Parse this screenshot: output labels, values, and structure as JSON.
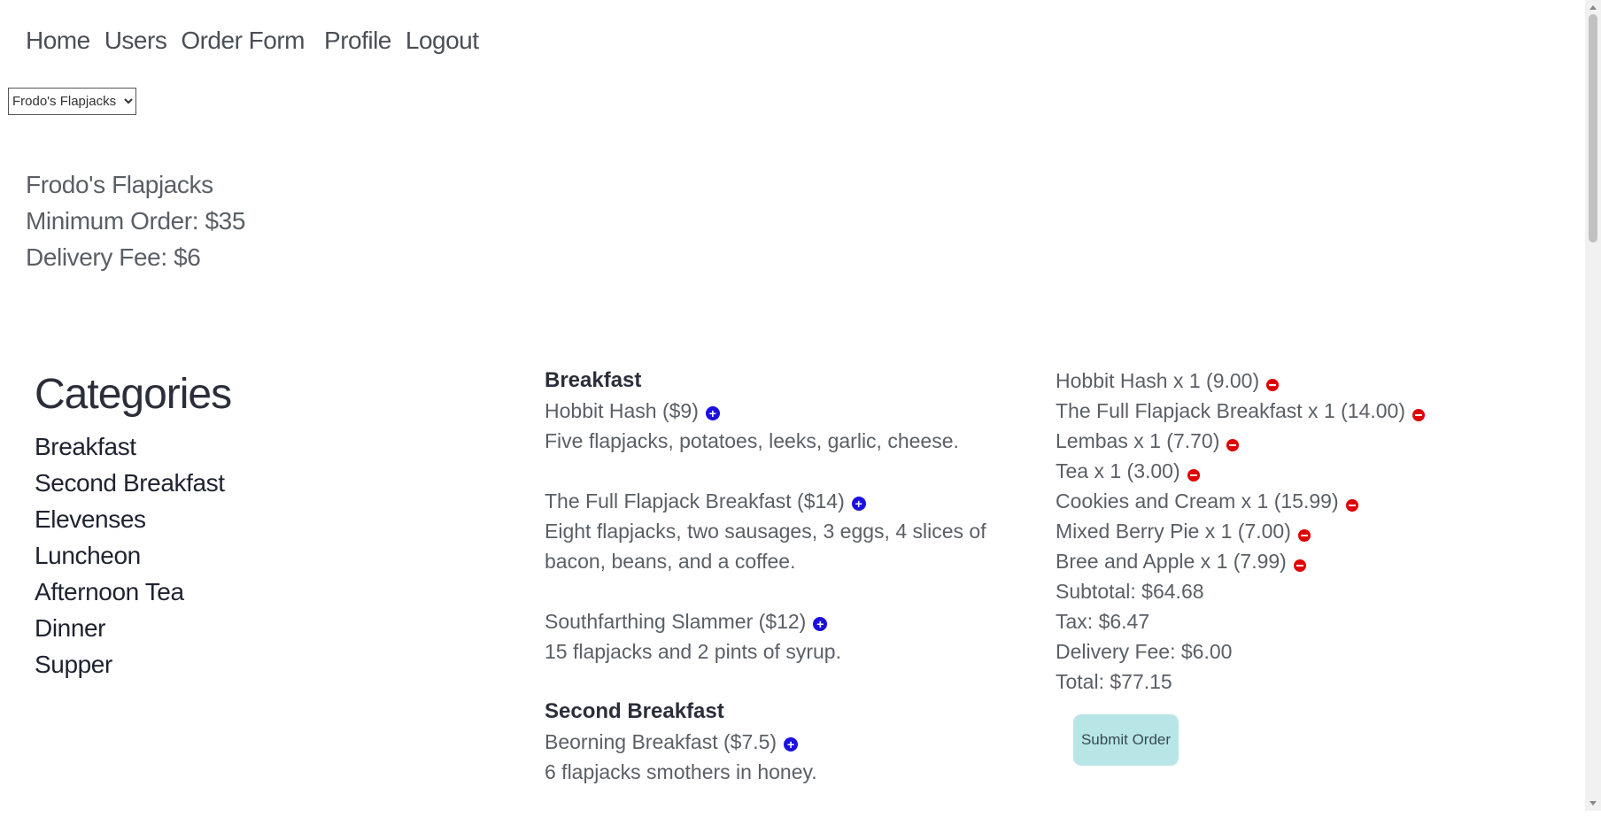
{
  "nav": [
    {
      "label": "Home"
    },
    {
      "label": "Users"
    },
    {
      "label": "Order Form"
    },
    {
      "label": "Profile"
    },
    {
      "label": "Logout"
    }
  ],
  "restaurant_select": {
    "selected": "Frodo's Flapjacks"
  },
  "restaurant": {
    "name": "Frodo's Flapjacks",
    "minimum_order": "Minimum Order: $35",
    "delivery_fee": "Delivery Fee: $6"
  },
  "categories": {
    "heading": "Categories",
    "items": [
      "Breakfast",
      "Second Breakfast",
      "Elevenses",
      "Luncheon",
      "Afternoon Tea",
      "Dinner",
      "Supper"
    ]
  },
  "menu": {
    "sections": [
      {
        "category": "Breakfast",
        "items": [
          {
            "name": "Hobbit Hash ($9)",
            "description": "Five flapjacks, potatoes, leeks, garlic, cheese."
          },
          {
            "name": "The Full Flapjack Breakfast ($14)",
            "description": "Eight flapjacks, two sausages, 3 eggs, 4 slices of bacon, beans, and a coffee."
          },
          {
            "name": "Southfarthing Slammer ($12)",
            "description": "15 flapjacks and 2 pints of syrup."
          }
        ]
      },
      {
        "category": "Second Breakfast",
        "items": [
          {
            "name": "Beorning Breakfast ($7.5)",
            "description": "6 flapjacks smothers in honey."
          }
        ]
      }
    ]
  },
  "cart": {
    "items": [
      "Hobbit Hash x 1 (9.00)",
      "The Full Flapjack Breakfast x 1 (14.00)",
      "Lembas x 1 (7.70)",
      "Tea x 1 (3.00)",
      "Cookies and Cream x 1 (15.99)",
      "Mixed Berry Pie x 1 (7.00)",
      "Bree and Apple x 1 (7.99)"
    ],
    "subtotal": "Subtotal: $64.68",
    "tax": "Tax: $6.47",
    "delivery_fee": "Delivery Fee: $6.00",
    "total": "Total: $77.15",
    "submit_label": "Submit Order"
  },
  "colors": {
    "add_icon": "#1b10e0",
    "remove_icon": "#e00000",
    "submit_button": "#b8e6e6"
  }
}
